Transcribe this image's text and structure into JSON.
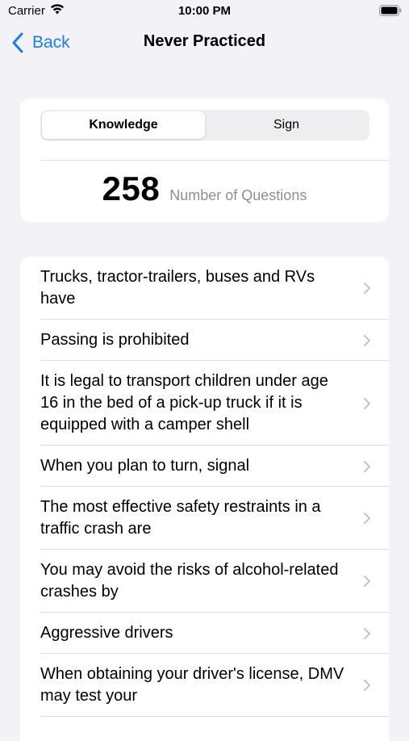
{
  "status_bar": {
    "carrier": "Carrier",
    "time": "10:00 PM"
  },
  "nav": {
    "back_label": "Back",
    "title": "Never Practiced"
  },
  "segments": [
    {
      "label": "Knowledge",
      "selected": true
    },
    {
      "label": "Sign",
      "selected": false
    }
  ],
  "summary": {
    "count": "258",
    "count_label": "Number of Questions"
  },
  "questions": [
    "Trucks, tractor-trailers, buses and RVs have",
    "Passing is prohibited",
    "It is legal to transport children under age 16 in the bed of a pick-up truck if it is equipped with a camper shell",
    "When you plan to turn, signal",
    "The most effective safety restraints in a traffic crash are",
    "You may avoid the risks of alcohol-related crashes by",
    "Aggressive drivers",
    "When obtaining your driver's license, DMV may test your"
  ],
  "colors": {
    "accent": "#1a7cf5",
    "background": "#f2f2f7",
    "secondary_text": "#8e8e93"
  },
  "icons": {
    "back": "chevron-left-icon",
    "row": "chevron-right-icon",
    "wifi": "wifi-icon",
    "battery": "battery-icon"
  }
}
